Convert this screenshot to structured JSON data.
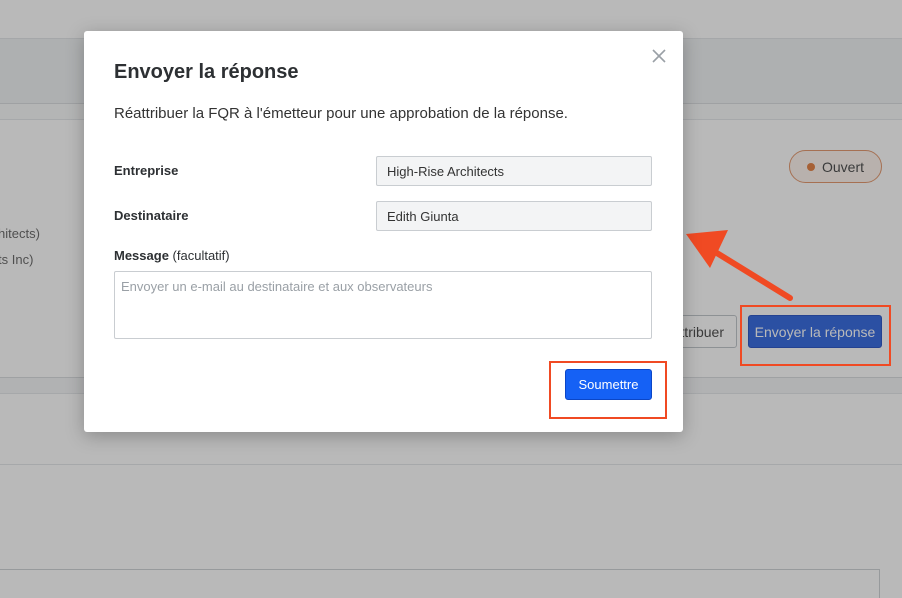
{
  "background": {
    "partial_text_1": "hitects)",
    "partial_text_2": "ts Inc)",
    "status_label": "Ouvert",
    "reattribuer_partial": "ttribuer",
    "send_response_label": "Envoyer la réponse"
  },
  "modal": {
    "title": "Envoyer la réponse",
    "description": "Réattribuer la FQR à l'émetteur pour une approbation de la réponse.",
    "company_label": "Entreprise",
    "company_value": "High-Rise Architects",
    "recipient_label": "Destinataire",
    "recipient_value": "Edith Giunta",
    "message_label": "Message",
    "message_optional": "(facultatif)",
    "message_placeholder": "Envoyer un e-mail au destinataire et aux observateurs",
    "submit_label": "Soumettre"
  },
  "colors": {
    "primary_button": "#1561f5",
    "highlight": "#f04a23",
    "status_dot": "#e0702a"
  }
}
